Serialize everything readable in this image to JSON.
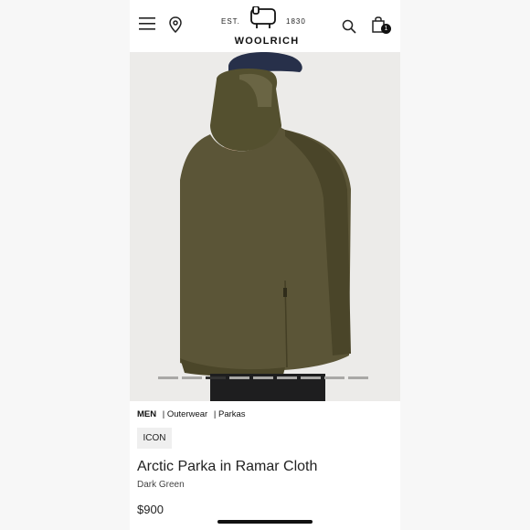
{
  "header": {
    "logo": {
      "est": "EST.",
      "year": "1830",
      "brand": "WOOLRICH"
    },
    "bag_count": "1",
    "icons": [
      "menu-icon",
      "location-pin-icon",
      "search-icon",
      "shopping-bag-icon",
      "sheep-logo-icon"
    ]
  },
  "product": {
    "breadcrumb": [
      "MEN",
      "| Outerwear",
      "| Parkas"
    ],
    "badge": "ICON",
    "name": "Arctic Parka in Ramar Cloth",
    "color": "Dark Green",
    "price": "$900"
  },
  "gallery": {
    "image_count": 9,
    "active_index": 2
  },
  "colors": {
    "coat": "#5b5537",
    "cap": "#27304a",
    "background": "#ecebe9"
  }
}
